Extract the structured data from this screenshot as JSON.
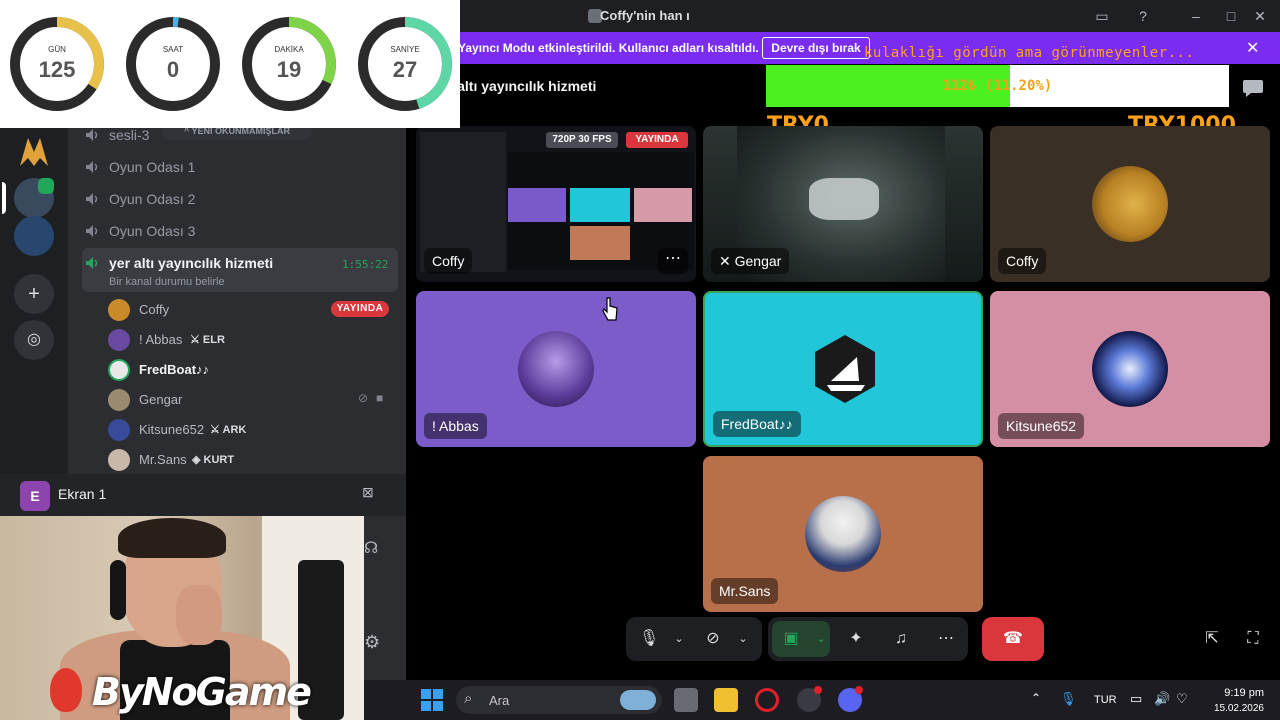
{
  "window": {
    "title": "Coffy'nin han ı"
  },
  "countdown": [
    {
      "label": "GÜN",
      "value": "125",
      "fraction": 0.34,
      "color": "#e7c14a"
    },
    {
      "label": "SAAT",
      "value": "0",
      "fraction": 0.02,
      "color": "#4fb0e0"
    },
    {
      "label": "DAKİKA",
      "value": "19",
      "fraction": 0.32,
      "color": "#7ed348"
    },
    {
      "label": "SANİYE",
      "value": "27",
      "fraction": 0.45,
      "color": "#5fd6a8"
    }
  ],
  "banner": {
    "text": "Yayıncı Modu etkinleştirildi. Kullanıcı adları kısaltıldı.",
    "button": "Devre dışı bırak",
    "ticker": "kulaklığı gördün ama görünmeyenler..."
  },
  "header": {
    "channel": "er altı yayıncılık hizmeti"
  },
  "donation": {
    "text": "112₺ (11.20%)",
    "progress": 0.112,
    "left_label": "TRY0",
    "right_label": "TRY1000"
  },
  "sidebar": {
    "unread_pill": "^ YENİ OKUNMAMIŞLAR",
    "channels": [
      {
        "label": "sesli-3"
      },
      {
        "label": "Oyun Odası 1"
      },
      {
        "label": "Oyun Odası 2"
      },
      {
        "label": "Oyun Odası 3"
      }
    ],
    "active_channel": {
      "label": "yer altı yayıncılık hizmeti",
      "timer": "1:55:22",
      "status": "Bir kanal durumu belirle"
    },
    "users": [
      {
        "name": "Coffy",
        "badge": "YAYINDA",
        "color": "#c98a2a"
      },
      {
        "name": "! Abbas",
        "tag": "ELR",
        "color": "#6a4aa0"
      },
      {
        "name": "FredBoat♪♪",
        "color": "#e8e8e8"
      },
      {
        "name": "Gengar",
        "color": "#9a8a70"
      },
      {
        "name": "Kitsune652",
        "tag": "ARK",
        "color": "#3a4a9a"
      },
      {
        "name": "Mr.Sans",
        "tag": "KURT",
        "color": "#c9b8a8"
      }
    ]
  },
  "screen_share": {
    "icon_letter": "E",
    "label": "Ekran 1"
  },
  "tiles": [
    {
      "name": "Coffy",
      "quality": "720P 30 FPS",
      "live": "YAYINDA"
    },
    {
      "name": "Gengar"
    },
    {
      "name": "Coffy"
    },
    {
      "name": "! Abbas"
    },
    {
      "name": "FredBoat♪♪"
    },
    {
      "name": "Kitsune652"
    },
    {
      "name": "Mr.Sans"
    }
  ],
  "brand": {
    "text": "ByNoGame"
  },
  "taskbar": {
    "search": "Ara",
    "lang": "TUR",
    "time": "9:19 pm",
    "date": "15.02.2026"
  },
  "colors": {
    "banner": "#7a2cf0",
    "donation_fill": "#4cf020",
    "live": "#da373c",
    "end_call": "#da373c",
    "active_tile_border": "#3ba55d"
  }
}
